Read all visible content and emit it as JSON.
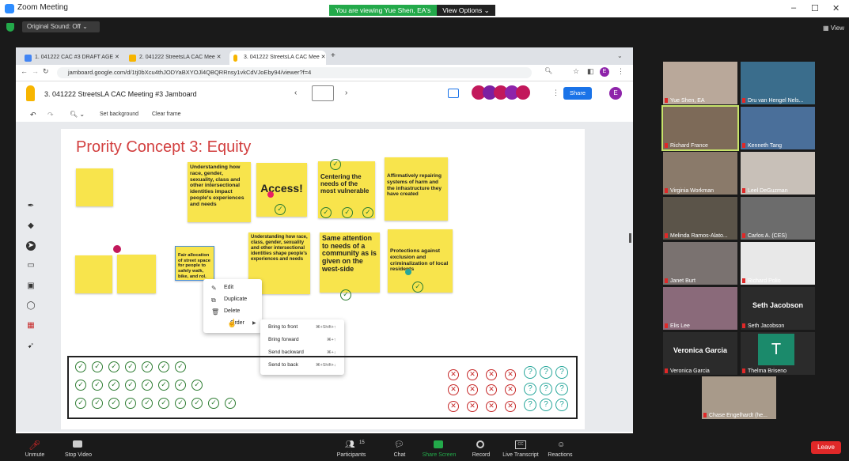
{
  "window": {
    "title": "Zoom Meeting",
    "viewing_banner": "You are viewing Yue Shen, EA's screen",
    "view_options": "View Options ⌄",
    "original_sound": "Original Sound: Off ⌄",
    "view_label": "View"
  },
  "browser": {
    "tabs": [
      {
        "label": "1. 041222 CAC #3 DRAFT AGE",
        "color": "#4285f4"
      },
      {
        "label": "2. 041222 StreetsLA CAC Mee",
        "color": "#f7b500"
      },
      {
        "label": "3. 041222 StreetsLA CAC Mee",
        "color": "#f7b500"
      }
    ],
    "url": "jamboard.google.com/d/1tj0bXcu4thJODYaBXYOJl4QBQRRnsy1vkCdVJoEby94/viewer?f=4"
  },
  "jamboard": {
    "title": "3. 041222 StreetsLA CAC Meeting #3 Jamboard",
    "share": "Share",
    "avatar": "E",
    "set_background": "Set background",
    "clear_frame": "Clear frame",
    "frame_title": "Prority Concept 3: Equity",
    "sticky_notes": {
      "n1": "Understanding how race, gender, sexuality, class and other intersectional identities impact people's experiences and needs",
      "n2": "Access!",
      "n3": "Centering the needs of the most vulnerable",
      "n4": "Affirmatively repairing systems of harm and the infrastructure they have created",
      "n5": "Fair allocation of street space for people to safely walk, bike, and rol.",
      "n6": "Understanding how race, class, gender, sexuality and other intersectional identities shape people's experiences and needs",
      "n7": "Same attention to needs of a community as is given on the west-side",
      "n8": "Protections against exclusion and criminalization of local residents"
    },
    "context_menu": [
      "Edit",
      "Duplicate",
      "Delete",
      "Order"
    ],
    "submenu": [
      {
        "label": "Bring to front",
        "shortcut": "⌘+Shift+↑"
      },
      {
        "label": "Bring forward",
        "shortcut": "⌘+↑"
      },
      {
        "label": "Send backward",
        "shortcut": "⌘+↓"
      },
      {
        "label": "Send to back",
        "shortcut": "⌘+Shift+↓"
      }
    ]
  },
  "participants": [
    "Yue Shen, EA",
    "Dru van Hengel Nels...",
    "Richard France",
    "Kenneth Tang",
    "Virginia Workman",
    "Leel DeGuzman",
    "Melinda Ramos-Alato...",
    "Carlos A. (CES)",
    "Janet Burt",
    "Richard Polio",
    "Elis Lee",
    "Seth Jacobson",
    "Veronica Garcia",
    "Thelma Briseno",
    "Chase Engelhardt (he..."
  ],
  "tile_names": {
    "seth": "Seth Jacobson",
    "veronica": "Veronica Garcia",
    "thelma_initial": "T"
  },
  "toolbar": {
    "unmute": "Unmute",
    "stop_video": "Stop Video",
    "participants": "Participants",
    "participant_count": "15",
    "chat": "Chat",
    "share_screen": "Share Screen",
    "record": "Record",
    "live_transcript": "Live Transcript",
    "reactions": "Reactions",
    "leave": "Leave"
  }
}
